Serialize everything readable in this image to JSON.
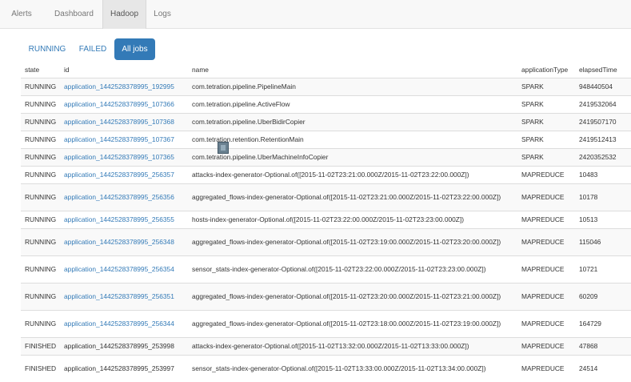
{
  "nav": {
    "tabs": [
      {
        "label": "Alerts"
      },
      {
        "label": "Dashboard"
      },
      {
        "label": "Hadoop"
      },
      {
        "label": "Logs"
      }
    ],
    "active_tab": "Hadoop"
  },
  "filters": {
    "pills": [
      {
        "label": "RUNNING"
      },
      {
        "label": "FAILED"
      },
      {
        "label": "All jobs"
      }
    ],
    "active": "All jobs"
  },
  "table": {
    "columns": [
      "state",
      "id",
      "name",
      "applicationType",
      "elapsedTime"
    ],
    "rows": [
      {
        "state": "RUNNING",
        "id": "application_1442528378995_192995",
        "name": "com.tetration.pipeline.PipelineMain",
        "type": "SPARK",
        "elapsed": "948440504",
        "link": true
      },
      {
        "state": "RUNNING",
        "id": "application_1442528378995_107366",
        "name": "com.tetration.pipeline.ActiveFlow",
        "type": "SPARK",
        "elapsed": "2419532064",
        "link": true
      },
      {
        "state": "RUNNING",
        "id": "application_1442528378995_107368",
        "name": "com.tetration.pipeline.UberBidirCopier",
        "type": "SPARK",
        "elapsed": "2419507170",
        "link": true
      },
      {
        "state": "RUNNING",
        "id": "application_1442528378995_107367",
        "name": "com.tetration.retention.RetentionMain",
        "type": "SPARK",
        "elapsed": "2419512413",
        "link": true
      },
      {
        "state": "RUNNING",
        "id": "application_1442528378995_107365",
        "name": "com.tetration.pipeline.UberMachineInfoCopier",
        "type": "SPARK",
        "elapsed": "2420352532",
        "link": true
      },
      {
        "state": "RUNNING",
        "id": "application_1442528378995_256357",
        "name": "attacks-index-generator-Optional.of([2015-11-02T23:21:00.000Z/2015-11-02T23:22:00.000Z])",
        "type": "MAPREDUCE",
        "elapsed": "10483",
        "link": true
      },
      {
        "state": "RUNNING",
        "id": "application_1442528378995_256356",
        "name": "aggregated_flows-index-generator-Optional.of([2015-11-02T23:21:00.000Z/2015-11-02T23:22:00.000Z])",
        "type": "MAPREDUCE",
        "elapsed": "10178",
        "link": true
      },
      {
        "state": "RUNNING",
        "id": "application_1442528378995_256355",
        "name": "hosts-index-generator-Optional.of([2015-11-02T23:22:00.000Z/2015-11-02T23:23:00.000Z])",
        "type": "MAPREDUCE",
        "elapsed": "10513",
        "link": true
      },
      {
        "state": "RUNNING",
        "id": "application_1442528378995_256348",
        "name": "aggregated_flows-index-generator-Optional.of([2015-11-02T23:19:00.000Z/2015-11-02T23:20:00.000Z])",
        "type": "MAPREDUCE",
        "elapsed": "115046",
        "link": true
      },
      {
        "state": "RUNNING",
        "id": "application_1442528378995_256354",
        "name": "sensor_stats-index-generator-Optional.of([2015-11-02T23:22:00.000Z/2015-11-02T23:23:00.000Z])",
        "type": "MAPREDUCE",
        "elapsed": "10721",
        "link": true
      },
      {
        "state": "RUNNING",
        "id": "application_1442528378995_256351",
        "name": "aggregated_flows-index-generator-Optional.of([2015-11-02T23:20:00.000Z/2015-11-02T23:21:00.000Z])",
        "type": "MAPREDUCE",
        "elapsed": "60209",
        "link": true
      },
      {
        "state": "RUNNING",
        "id": "application_1442528378995_256344",
        "name": "aggregated_flows-index-generator-Optional.of([2015-11-02T23:18:00.000Z/2015-11-02T23:19:00.000Z])",
        "type": "MAPREDUCE",
        "elapsed": "164729",
        "link": true
      },
      {
        "state": "FINISHED",
        "id": "application_1442528378995_253998",
        "name": "attacks-index-generator-Optional.of([2015-11-02T13:32:00.000Z/2015-11-02T13:33:00.000Z])",
        "type": "MAPREDUCE",
        "elapsed": "47868",
        "link": false
      },
      {
        "state": "FINISHED",
        "id": "application_1442528378995_253997",
        "name": "sensor_stats-index-generator-Optional.of([2015-11-02T13:33:00.000Z/2015-11-02T13:34:00.000Z])",
        "type": "MAPREDUCE",
        "elapsed": "24514",
        "link": false
      }
    ]
  },
  "colors": {
    "link": "#337ab7",
    "active_pill_bg": "#337ab7",
    "nav_bg": "#f8f8f8",
    "active_tab_bg": "#e7e7e7",
    "row_stripe": "#f9f9f9",
    "border": "#dddddd"
  }
}
